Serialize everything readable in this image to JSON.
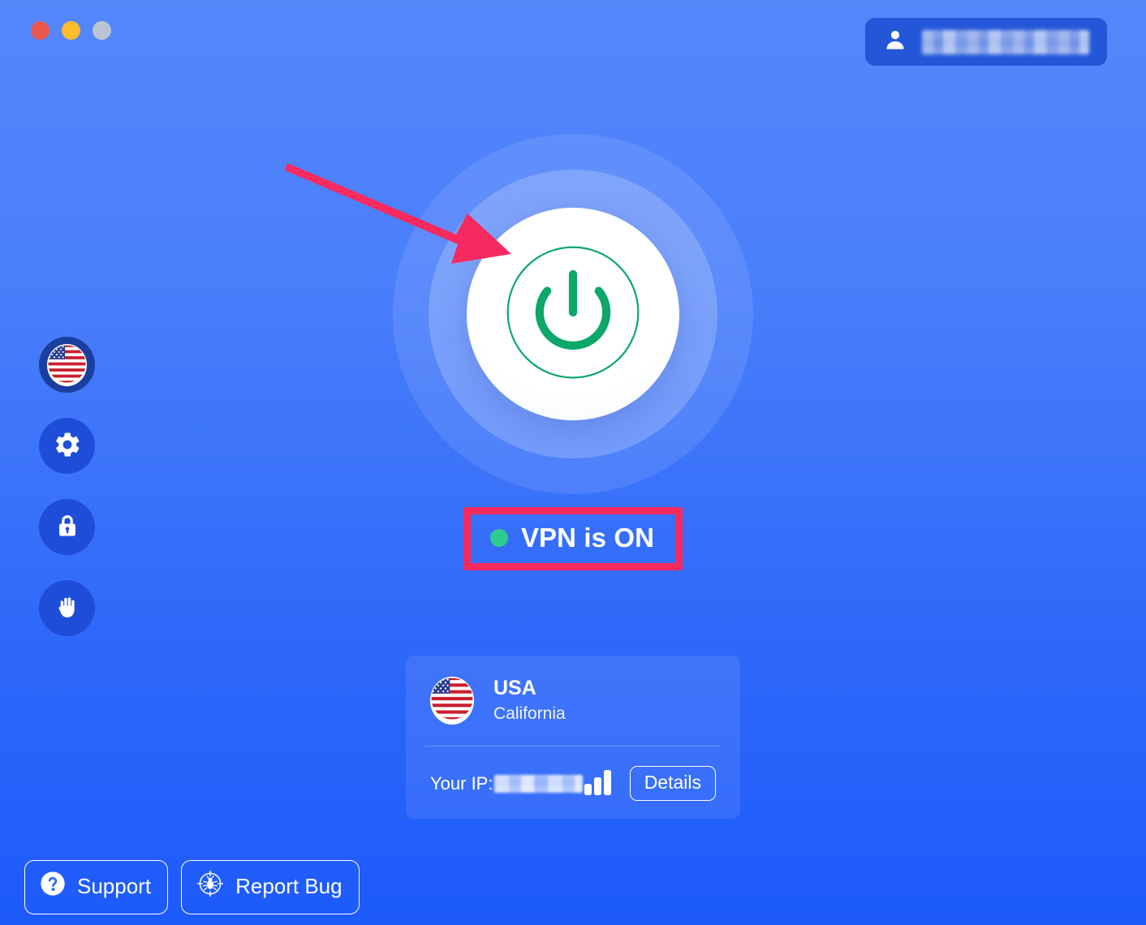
{
  "window": {
    "traffic_lights": [
      {
        "name": "close",
        "color": "#e9574e"
      },
      {
        "name": "minimize",
        "color": "#fcbc2c"
      },
      {
        "name": "zoom",
        "color": "#b9c5d3"
      }
    ]
  },
  "theme": {
    "bg_top": "#5587fb",
    "bg_bottom": "#1d5afb",
    "accent_green": "#0da66b",
    "status_dot_green": "#2ecc8f",
    "annotation_pink": "#f62a5f",
    "sidebar_circle": "#1e4ed8",
    "account_pill": "#2457d8"
  },
  "account": {
    "icon": "person-icon",
    "email": "",
    "email_redacted": true
  },
  "sidebar": {
    "items": [
      {
        "icon": "usa-flag-icon",
        "label": "Country"
      },
      {
        "icon": "gear-icon",
        "label": "Settings"
      },
      {
        "icon": "lock-icon",
        "label": "Security"
      },
      {
        "icon": "hand-icon",
        "label": "Block"
      }
    ]
  },
  "power": {
    "icon": "power-icon",
    "state": "on"
  },
  "status": {
    "dot_icon": "status-dot-icon",
    "text": "VPN is ON",
    "annotated": true
  },
  "server": {
    "flag_icon": "usa-flag-icon",
    "country": "USA",
    "region": "California",
    "ip_label": "Your IP:",
    "ip_value": "",
    "ip_redacted": true,
    "signal_icon": "signal-bars-icon",
    "details_label": "Details"
  },
  "bottom": {
    "support": {
      "icon": "question-mark-icon",
      "label": "Support"
    },
    "report_bug": {
      "icon": "bug-target-icon",
      "label": "Report Bug"
    }
  },
  "annotations": {
    "arrow": {
      "icon": "pointer-arrow",
      "color": "#f62a5f",
      "points_to": "power-button"
    },
    "box": {
      "color": "#f62a5f",
      "around": "status-badge"
    }
  }
}
